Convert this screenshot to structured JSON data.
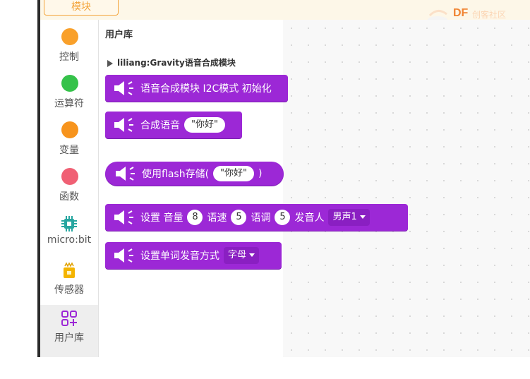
{
  "top": {
    "module_label": "模块",
    "logo_text": "DF",
    "logo_subtext": "创客社区"
  },
  "sidebar": {
    "categories": [
      {
        "label": "控制",
        "color": "#f9a02a"
      },
      {
        "label": "运算符",
        "color": "#35c24a"
      },
      {
        "label": "变量",
        "color": "#f7941d"
      },
      {
        "label": "函数",
        "color": "#f06074"
      },
      {
        "label": "micro:bit",
        "icon": "chip-icon"
      },
      {
        "label": "传感器",
        "icon": "sensor-chip-icon"
      },
      {
        "label": "用户库",
        "icon": "user-library-icon",
        "active": true
      }
    ]
  },
  "flyout": {
    "title": "用户库",
    "extension": "liliang:Gravity语音合成模块",
    "blocks": {
      "init": {
        "text": "语音合成模块 I2C模式 初始化"
      },
      "speak": {
        "text": "合成语音",
        "value": "\"你好\""
      },
      "flash": {
        "text": "使用flash存储(",
        "value": "\"你好\"",
        "close": ")"
      },
      "settings": {
        "prefix": "设置 音量",
        "volume": "8",
        "speed_label": "语速",
        "speed": "5",
        "pitch_label": "语调",
        "pitch": "5",
        "speaker_label": "发音人",
        "speaker": "男声1"
      },
      "word_mode": {
        "text": "设置单词发音方式",
        "value": "字母"
      }
    },
    "block_color": "#9c28d6"
  }
}
